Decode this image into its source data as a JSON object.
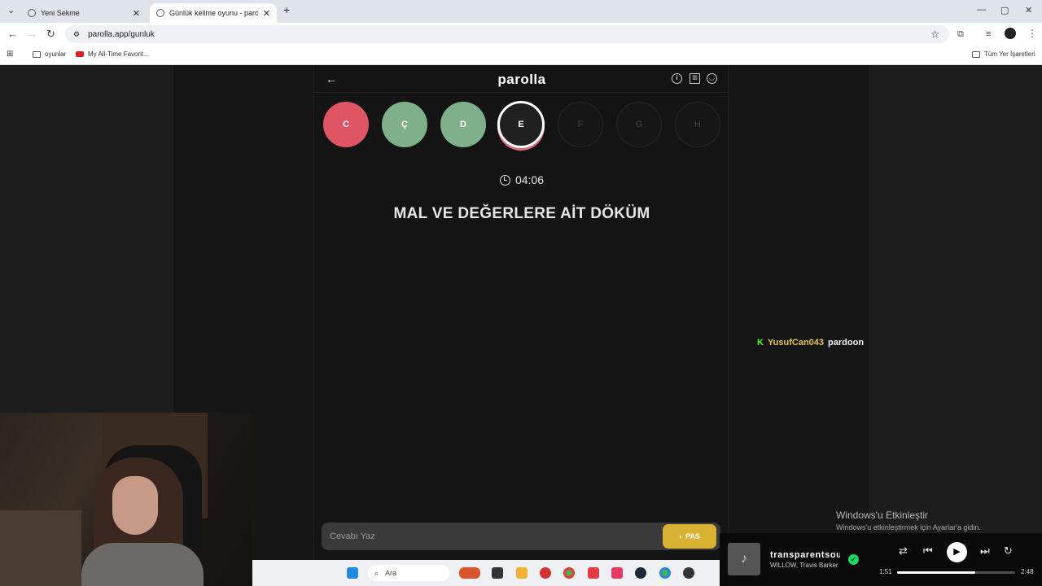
{
  "browser": {
    "tabs": [
      {
        "title": "Yeni Sekme",
        "active": false
      },
      {
        "title": "Günlük kelime oyunu - parolla",
        "active": true
      }
    ],
    "url": "parolla.app/gunluk",
    "bookmarks": [
      {
        "label": "oyunlar",
        "icon": "folder-icon"
      },
      {
        "label": "My All-Time Favorit...",
        "icon": "youtube-icon"
      }
    ],
    "all_bookmarks_label": "Tüm Yer İşaretleri"
  },
  "game": {
    "logo": "parolla",
    "letters": [
      {
        "letter": "C",
        "state": "wrong"
      },
      {
        "letter": "Ç",
        "state": "correct"
      },
      {
        "letter": "D",
        "state": "correct"
      },
      {
        "letter": "E",
        "state": "active"
      },
      {
        "letter": "F",
        "state": "empty"
      },
      {
        "letter": "G",
        "state": "empty"
      },
      {
        "letter": "H",
        "state": "empty"
      }
    ],
    "timer": "04:06",
    "clue": "MAL VE DEĞERLERE AİT DÖKÜM",
    "answer_placeholder": "Cevabı Yaz",
    "pass_label": "PAS"
  },
  "chat": {
    "platform_icon": "kick-icon",
    "username": "YusufCan043",
    "message": "pardoon"
  },
  "windows_activation": {
    "title": "Windows'u Etkinleştir",
    "subtitle": "Windows'u etkinleştirmek için Ayarlar'a gidin."
  },
  "taskbar": {
    "search_label": "Ara"
  },
  "media": {
    "title": "transparentsoul",
    "artist": "WILLOW, Travis Barker",
    "elapsed": "1:51",
    "total": "2:48",
    "progress": 0.66
  },
  "colors": {
    "wrong": "#e05565",
    "correct": "#7fb08a",
    "pass_button": "#d9b233",
    "chat_username": "#e5c45a"
  }
}
